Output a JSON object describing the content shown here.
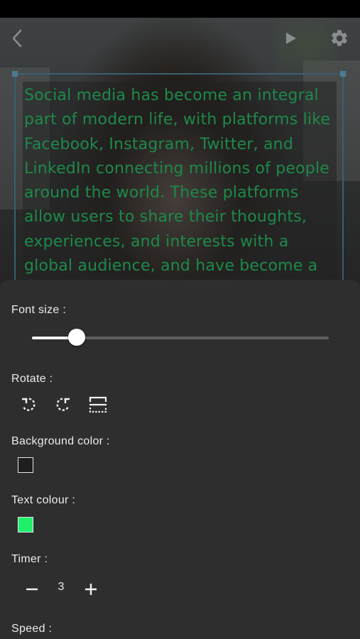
{
  "toolbar": {
    "back_icon": "chevron-left-icon",
    "play_icon": "play-icon",
    "settings_icon": "gear-icon"
  },
  "prompter": {
    "lines": [
      "Social media has become an integral",
      "part of modern life, with platforms like",
      "Facebook, Instagram, Twitter, and",
      "LinkedIn connecting millions of people",
      "around the world. These platforms",
      "allow users to share their thoughts,",
      "experiences, and interests with a",
      "global audience, and have become a"
    ],
    "text_color": "#1d8a4a",
    "box_border_color": "#3a5f72"
  },
  "settings": {
    "font_size": {
      "label": "Font size :",
      "value_fraction": 0.15
    },
    "rotate": {
      "label": "Rotate :",
      "buttons": [
        "rotate-left-icon",
        "rotate-right-icon",
        "flip-icon"
      ]
    },
    "background_color": {
      "label": "Background color :",
      "value": "#1e1e1e"
    },
    "text_colour": {
      "label": "Text colour :",
      "value": "#1ef06a"
    },
    "timer": {
      "label": "Timer :",
      "value": "3",
      "decrement_icon": "minus-icon",
      "increment_icon": "plus-icon"
    },
    "speed": {
      "label": "Speed :"
    }
  },
  "colors": {
    "panel_bg": "#2e2e2e",
    "accent": "#ffffff"
  }
}
